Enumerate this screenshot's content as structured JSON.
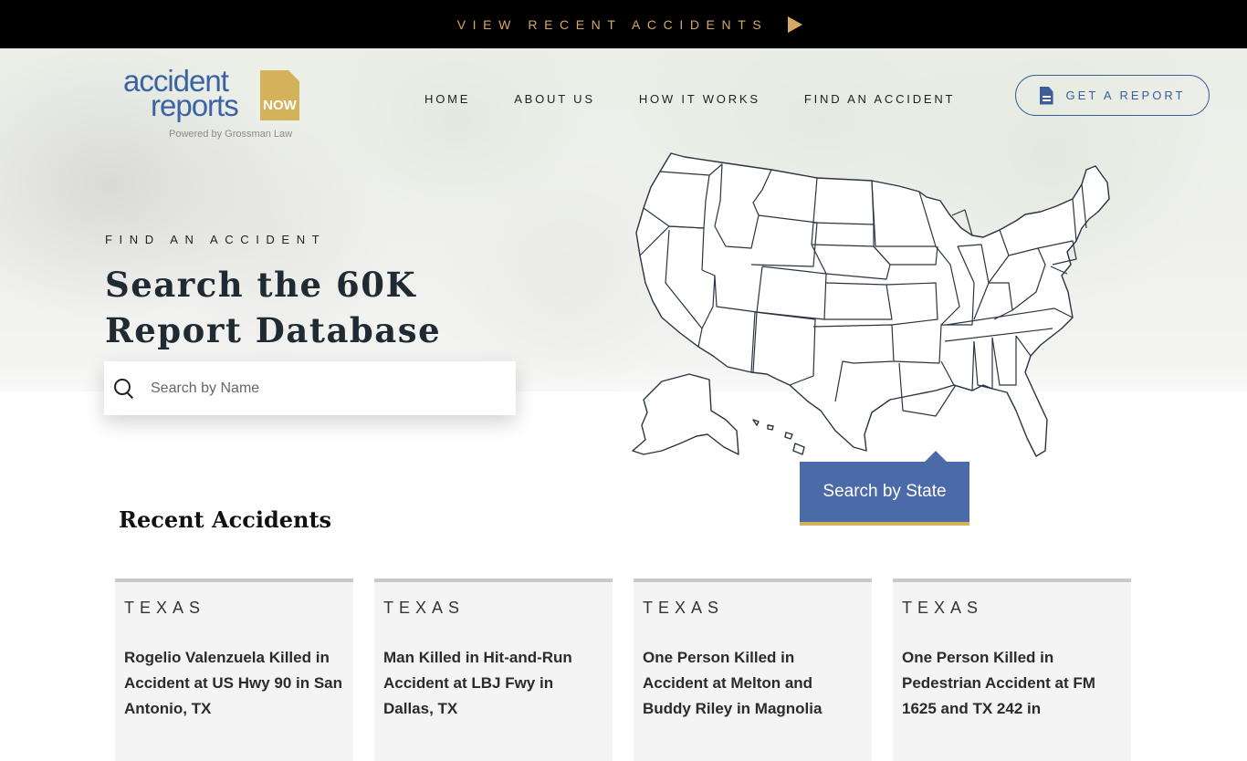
{
  "topbar": {
    "label": "VIEW RECENT ACCIDENTS",
    "icon": "play-icon",
    "color": "#d7a867"
  },
  "logo": {
    "line1": "accident",
    "line2": "reports",
    "badge": "NOW",
    "powered": "Powered by Grossman Law"
  },
  "nav": {
    "items": [
      {
        "label": "HOME"
      },
      {
        "label": "ABOUT US"
      },
      {
        "label": "HOW IT WORKS"
      },
      {
        "label": "FIND AN ACCIDENT"
      }
    ],
    "report_button": "GET A REPORT"
  },
  "hero": {
    "eyebrow": "FIND AN ACCIDENT",
    "headline": "Search the 60K Report Database",
    "search_placeholder": "Search by Name"
  },
  "map": {
    "button_label": "Search by State"
  },
  "recent": {
    "title": "Recent Accidents",
    "cards": [
      {
        "state": "TEXAS",
        "title": "Rogelio Valenzuela Killed in Accident at US Hwy 90 in San Antonio, TX"
      },
      {
        "state": "TEXAS",
        "title": "Man Killed in Hit-and-Run Accident at LBJ Fwy in Dallas, TX"
      },
      {
        "state": "TEXAS",
        "title": "One Person Killed in Accident at Melton and Buddy Riley in Magnolia"
      },
      {
        "state": "TEXAS",
        "title": "One Person Killed in Pedestrian Accident at FM 1625 and TX 242 in"
      }
    ]
  },
  "colors": {
    "brand_blue": "#3a63a4",
    "gold": "#d4b15b",
    "button_blue": "#4a6aa8"
  }
}
